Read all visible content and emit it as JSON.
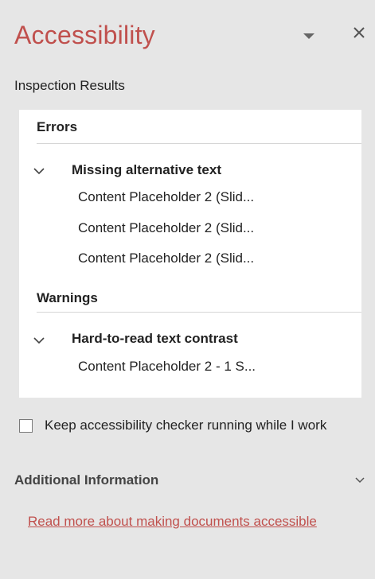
{
  "pane": {
    "title": "Accessibility",
    "subtitle": "Inspection Results"
  },
  "errors": {
    "heading": "Errors",
    "issue": "Missing alternative text",
    "items": [
      "Content Placeholder 2  (Slid...",
      "Content Placeholder 2  (Slid...",
      "Content Placeholder 2  (Slid..."
    ]
  },
  "warnings": {
    "heading": "Warnings",
    "issue": "Hard-to-read text contrast",
    "items": [
      "Content Placeholder 2 - 1 S..."
    ]
  },
  "keep_running": {
    "label": "Keep accessibility checker running while I work",
    "checked": false
  },
  "additional": {
    "heading": "Additional Information",
    "link": "Read more about making documents accessible"
  },
  "colors": {
    "accent": "#c0504d",
    "pane_bg": "#e6e6e6",
    "list_bg": "#ffffff"
  },
  "icons": [
    "pane-options-icon",
    "close-icon",
    "chevron-down-icon"
  ]
}
